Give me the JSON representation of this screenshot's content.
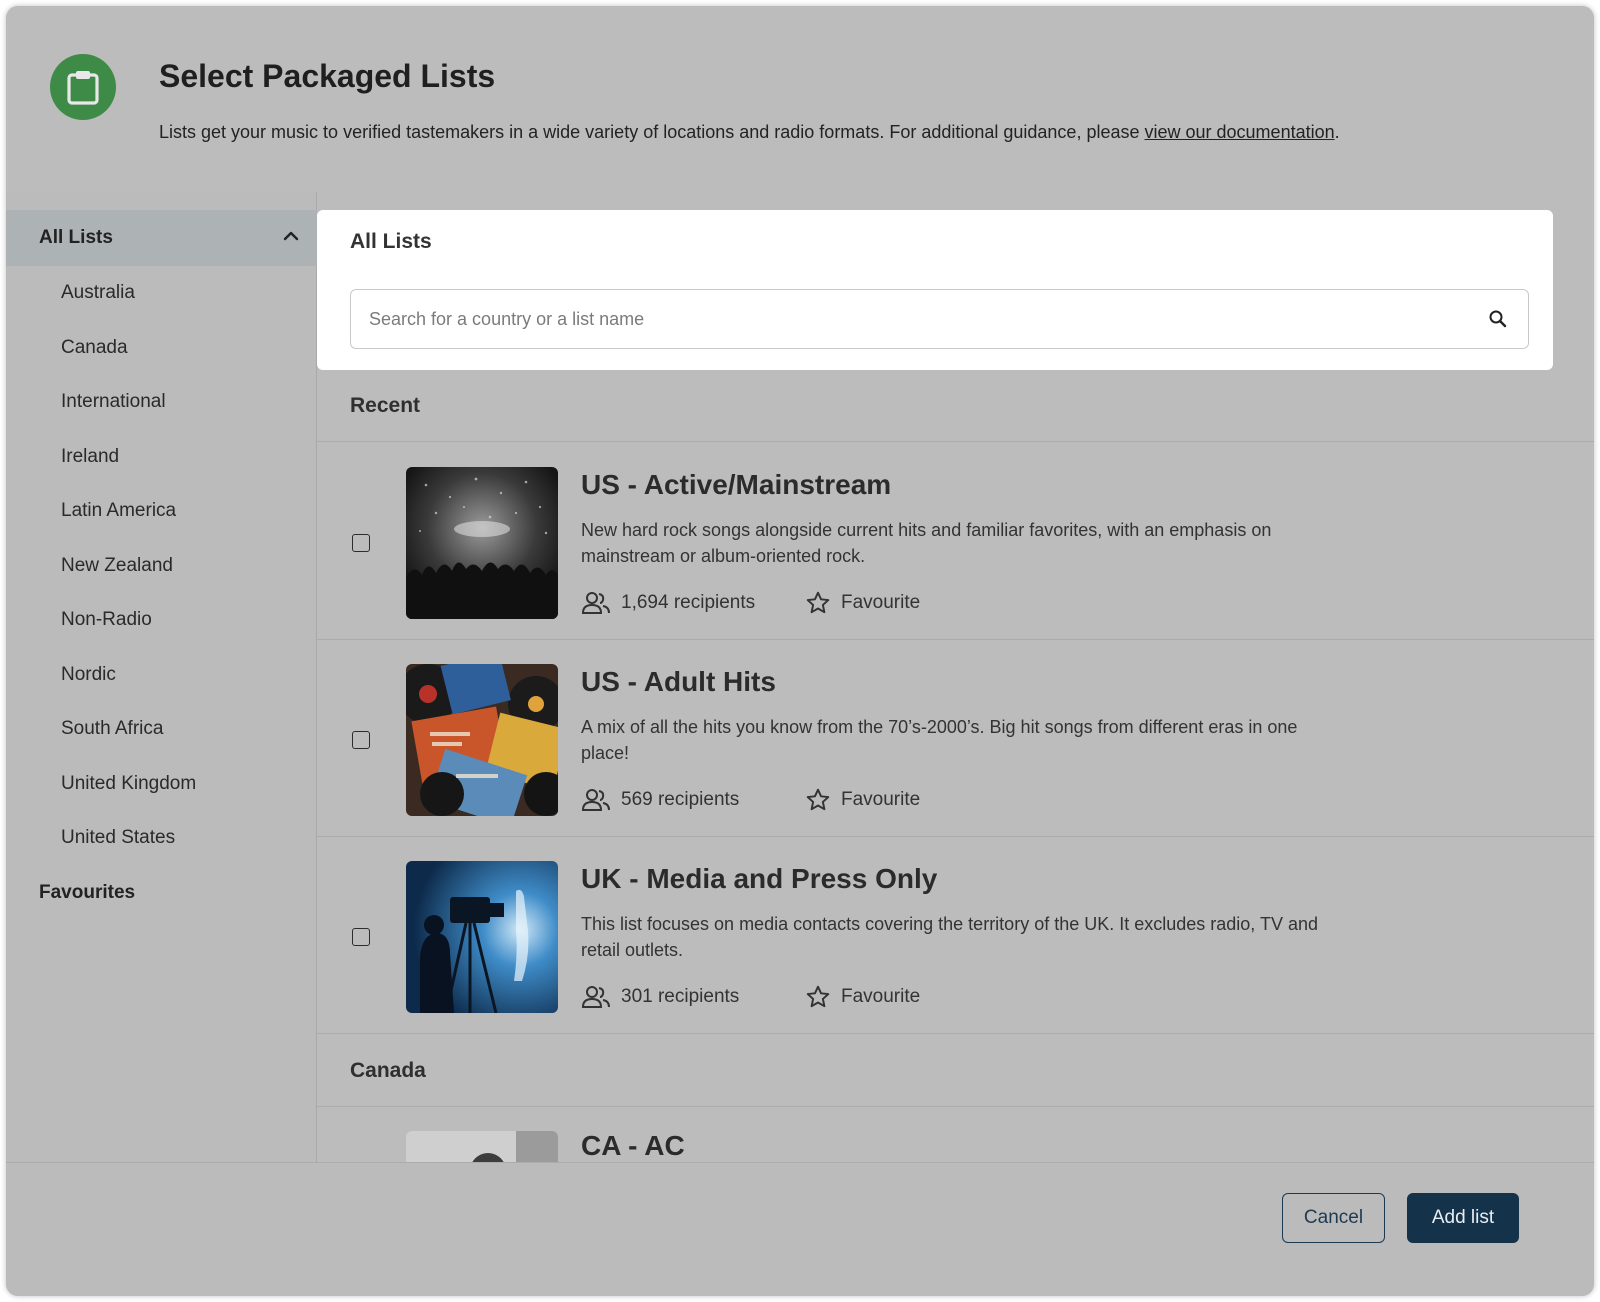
{
  "header": {
    "title": "Select Packaged Lists",
    "description": "Lists get your music to verified tastemakers in a wide variety of locations and radio formats. For additional guidance, please ",
    "link_text": "view our documentation",
    "trailing": ".",
    "icon": "clipboard-icon",
    "icon_color": "#3d8b47"
  },
  "sidebar": {
    "top_label": "All Lists",
    "items": [
      {
        "label": "Australia"
      },
      {
        "label": "Canada"
      },
      {
        "label": "International"
      },
      {
        "label": "Ireland"
      },
      {
        "label": "Latin America"
      },
      {
        "label": "New Zealand"
      },
      {
        "label": "Non-Radio"
      },
      {
        "label": "Nordic"
      },
      {
        "label": "South Africa"
      },
      {
        "label": "United Kingdom"
      },
      {
        "label": "United States"
      }
    ],
    "favourites_label": "Favourites"
  },
  "main": {
    "card_title": "All Lists",
    "search_placeholder": "Search for a country or a list name",
    "sections": [
      {
        "heading": "Recent"
      },
      {
        "heading": "Canada"
      }
    ],
    "lists": [
      {
        "title": "US - Active/Mainstream",
        "description": "New hard rock songs alongside current hits and familiar favorites, with an emphasis on mainstream or album-oriented rock.",
        "recipients": "1,694 recipients",
        "favourite": "Favourite"
      },
      {
        "title": "US - Adult Hits",
        "description": "A mix of all the hits you know from the 70’s-2000’s. Big hit songs from different eras in one place!",
        "recipients": "569 recipients",
        "favourite": "Favourite"
      },
      {
        "title": "UK - Media and Press Only",
        "description": "This list focuses on media contacts covering the territory of the UK. It excludes radio, TV and retail outlets.",
        "recipients": "301 recipients",
        "favourite": "Favourite"
      },
      {
        "title": "CA - AC"
      }
    ]
  },
  "footer": {
    "cancel_label": "Cancel",
    "add_label": "Add list",
    "primary_color": "#14324a"
  }
}
